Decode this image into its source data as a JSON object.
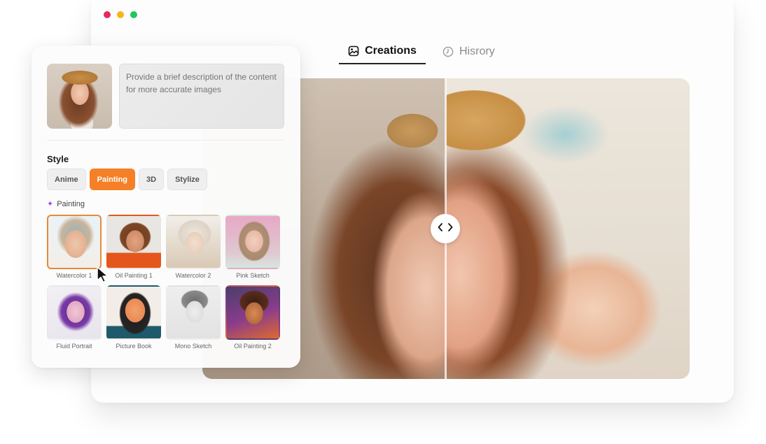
{
  "window": {
    "controls": [
      "close",
      "minimize",
      "maximize"
    ],
    "colors": {
      "close": "#e8285a",
      "minimize": "#f6b51b",
      "maximize": "#22c55e"
    }
  },
  "tabs": [
    {
      "label": "Creations",
      "icon": "image-icon",
      "active": true
    },
    {
      "label": "Hisrory",
      "icon": "clock-icon",
      "active": false
    }
  ],
  "upload": {
    "thumbnail_alt": "Uploaded photo of woman in straw hat"
  },
  "description": {
    "value": "",
    "placeholder": "Provide a brief description of the content for more accurate images"
  },
  "style": {
    "heading": "Style",
    "tabs": [
      {
        "label": "Anime",
        "active": false
      },
      {
        "label": "Painting",
        "active": true
      },
      {
        "label": "3D",
        "active": false
      },
      {
        "label": "Stylize",
        "active": false
      }
    ],
    "section_label": "Painting",
    "section_icon": "sparkle-icon",
    "presets": [
      {
        "label": "Watercolor 1",
        "selected": true
      },
      {
        "label": "Oil Painting 1",
        "selected": false
      },
      {
        "label": "Watercolor 2",
        "selected": false
      },
      {
        "label": "Pink Sketch",
        "selected": false
      },
      {
        "label": "Fluid Portrait",
        "selected": false
      },
      {
        "label": "Picture Book",
        "selected": false
      },
      {
        "label": "Mono Sketch",
        "selected": false
      },
      {
        "label": "Oil Painting 2",
        "selected": false
      }
    ]
  },
  "compare": {
    "before_alt": "Original photo",
    "after_alt": "Watercolor result",
    "handle_icon": "chevrons-left-right-icon"
  },
  "colors": {
    "accent": "#f58027",
    "selected_border": "#e58a3b",
    "sparkle": "#a645e6"
  }
}
